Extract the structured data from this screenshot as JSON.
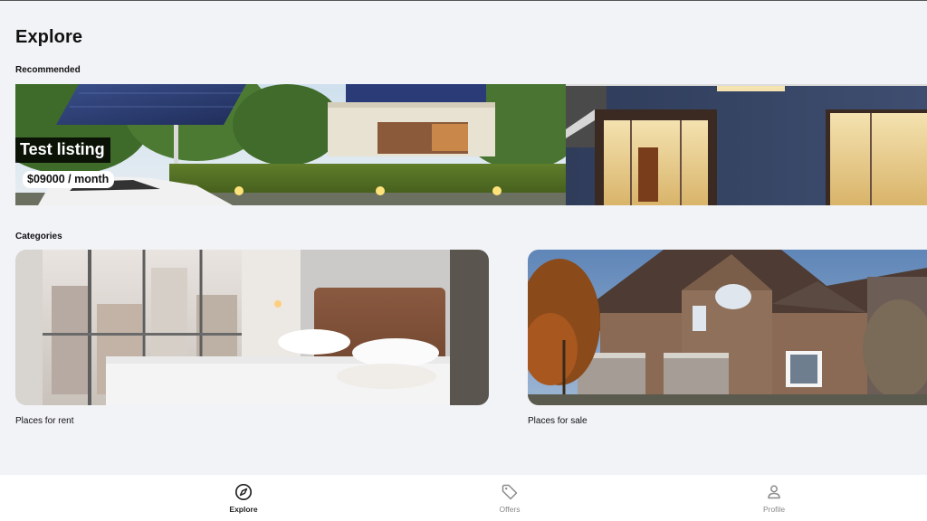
{
  "page": {
    "title": "Explore"
  },
  "sections": {
    "recommended": "Recommended",
    "categories": "Categories"
  },
  "recommended_listing": {
    "title": "Test listing",
    "price": "$09000 / month"
  },
  "categories": [
    {
      "label": "Places for rent"
    },
    {
      "label": "Places for sale"
    }
  ],
  "bottom_nav": {
    "items": [
      {
        "label": "Explore",
        "icon": "compass-icon",
        "active": true
      },
      {
        "label": "Offers",
        "icon": "tag-icon",
        "active": false
      },
      {
        "label": "Profile",
        "icon": "user-icon",
        "active": false
      }
    ]
  },
  "colors": {
    "background": "#f2f3f7",
    "nav_background": "#ffffff",
    "text_primary": "#111111",
    "nav_inactive": "#888888"
  }
}
